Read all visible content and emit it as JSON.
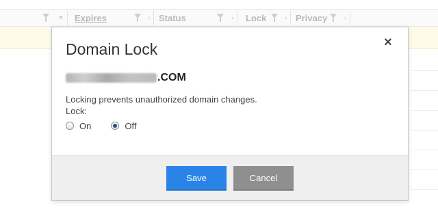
{
  "table": {
    "columns": [
      {
        "label": "Expires"
      },
      {
        "label": "Status"
      },
      {
        "label": "Lock"
      },
      {
        "label": "Privacy"
      }
    ]
  },
  "modal": {
    "title": "Domain Lock",
    "close_icon": "×",
    "domain_tld": ".COM",
    "description": "Locking prevents unauthorized domain changes.",
    "lock_label": "Lock:",
    "options": [
      {
        "label": "On",
        "checked": false
      },
      {
        "label": "Off",
        "checked": true
      }
    ],
    "save_label": "Save",
    "cancel_label": "Cancel"
  },
  "colors": {
    "save": "#2a84e8",
    "cancel": "#8f8f8f",
    "row_highlight": "#fffbe9"
  }
}
